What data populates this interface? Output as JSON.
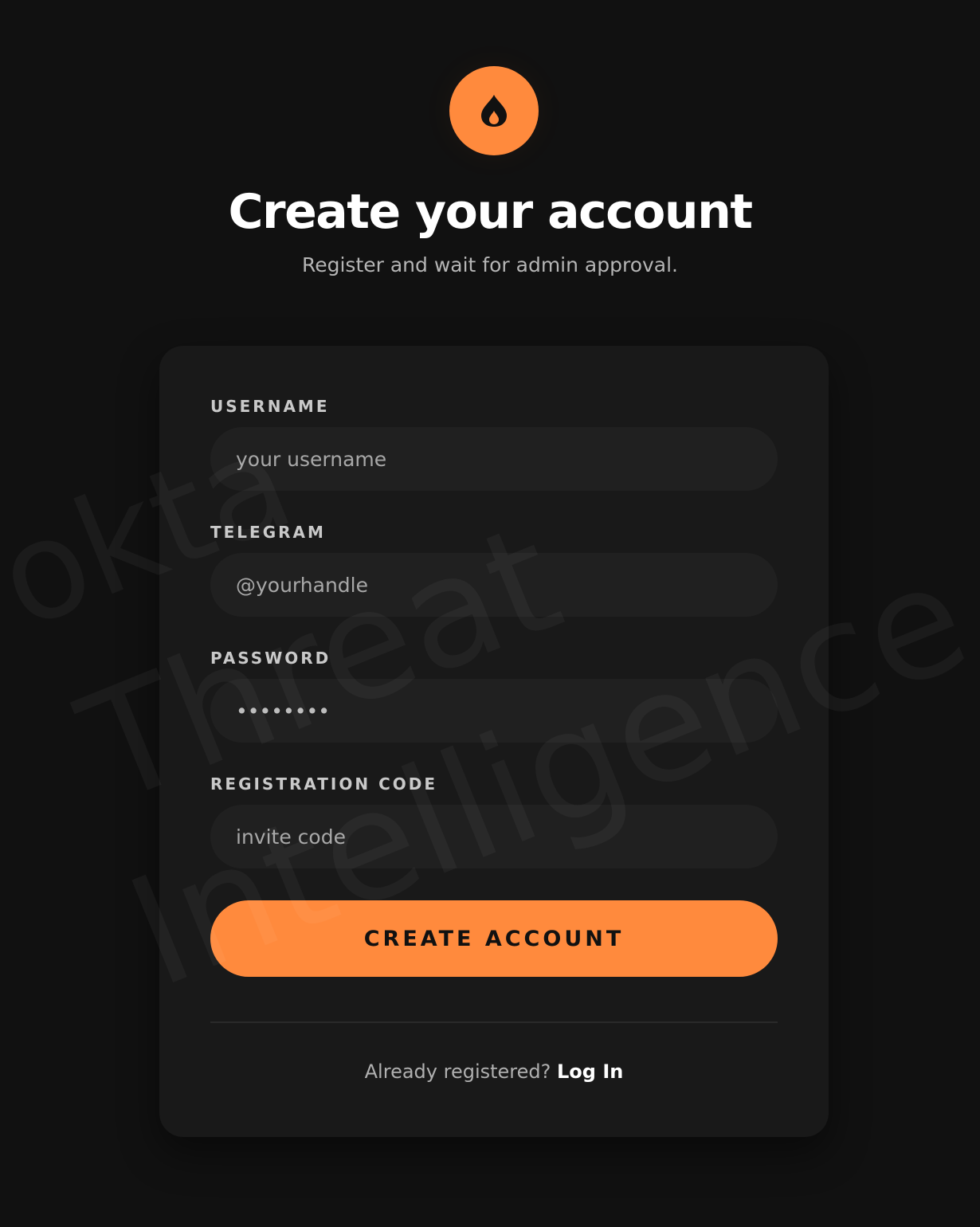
{
  "header": {
    "title": "Create your account",
    "subtitle": "Register and wait for admin approval."
  },
  "form": {
    "username": {
      "label": "USERNAME",
      "placeholder": "your username"
    },
    "telegram": {
      "label": "TELEGRAM",
      "placeholder": "@yourhandle"
    },
    "password": {
      "label": "PASSWORD",
      "placeholder": "••••••••"
    },
    "registration_code": {
      "label": "REGISTRATION CODE",
      "placeholder": "invite code"
    },
    "submit_label": "CREATE ACCOUNT"
  },
  "footer": {
    "prompt": "Already registered?",
    "login_label": "Log In"
  },
  "watermark": {
    "lines": [
      "okta",
      "Threat",
      "Intelligence"
    ]
  },
  "colors": {
    "background": "#111111",
    "card": "#191919",
    "input": "#202020",
    "accent": "#ff8a3d"
  },
  "icons": {
    "logo": "flame-icon"
  }
}
